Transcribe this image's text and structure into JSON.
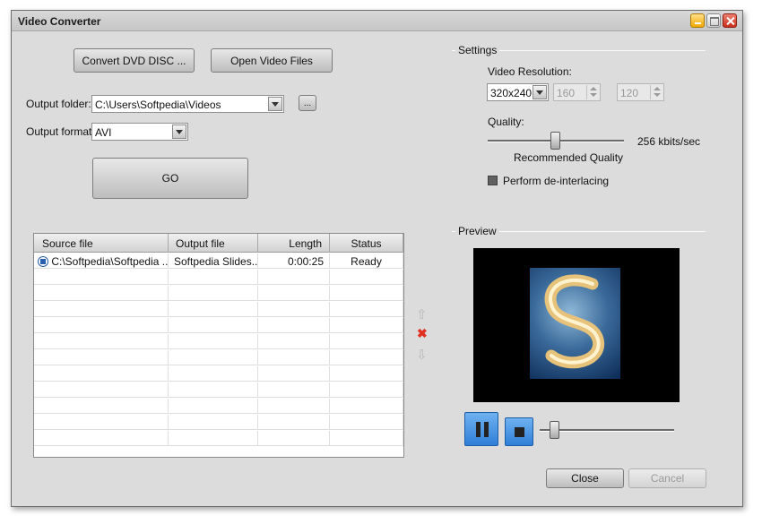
{
  "window": {
    "title": "Video Converter"
  },
  "toolbar": {
    "convert_dvd_label": "Convert DVD DISC ...",
    "open_files_label": "Open Video Files"
  },
  "output": {
    "folder_label": "Output folder:",
    "folder_value": "C:\\Users\\Softpedia\\Videos",
    "browse_label": "...",
    "format_label": "Output format:",
    "format_value": "AVI"
  },
  "go_label": "GO",
  "settings": {
    "group_title": "Settings",
    "resolution_label": "Video Resolution:",
    "resolution_value": "320x240",
    "width_value": "160",
    "height_value": "120",
    "quality_label": "Quality:",
    "quality_value_text": "256 kbits/sec",
    "quality_level": 0.5,
    "quality_caption": "Recommended Quality",
    "deinterlace_label": "Perform de-interlacing",
    "deinterlace_checked": false
  },
  "table": {
    "columns": [
      "Source file",
      "Output file",
      "Length",
      "Status"
    ],
    "rows": [
      {
        "source": "C:\\Softpedia\\Softpedia ...",
        "output": "Softpedia Slides...",
        "length": "0:00:25",
        "status": "Ready"
      }
    ]
  },
  "side_icons": [
    "move-up-icon",
    "remove-icon",
    "move-down-icon"
  ],
  "preview": {
    "group_title": "Preview",
    "position_level": 0.11
  },
  "footer": {
    "close_label": "Close",
    "cancel_label": "Cancel"
  },
  "colors": {
    "window_bg": "#dcdcdc",
    "pause_button": "#2f7fd8",
    "remove_icon": "#e03020"
  }
}
